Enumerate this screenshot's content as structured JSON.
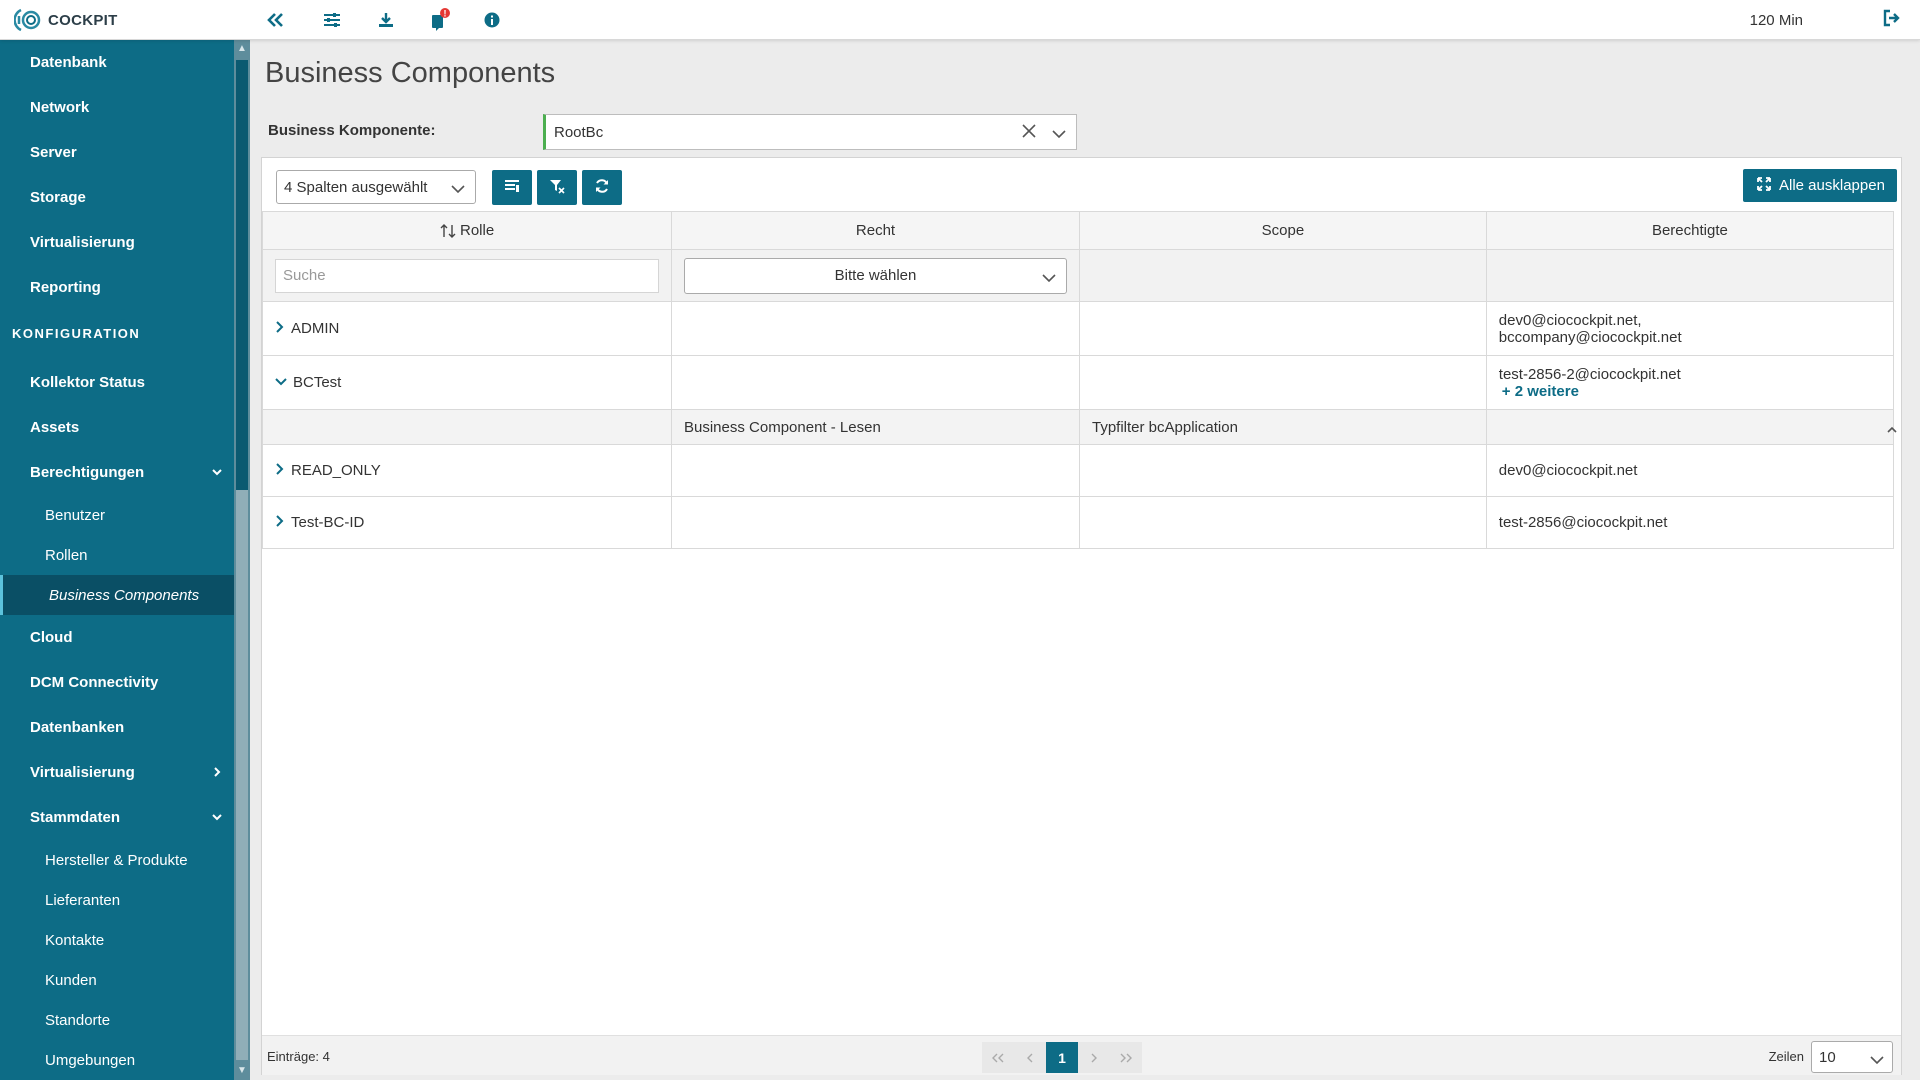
{
  "app": {
    "logo_text": "COCKPIT",
    "session_time": "120 Min"
  },
  "sidebar": {
    "items": [
      {
        "label": "Datenbank"
      },
      {
        "label": "Network"
      },
      {
        "label": "Server"
      },
      {
        "label": "Storage"
      },
      {
        "label": "Virtualisierung"
      },
      {
        "label": "Reporting"
      }
    ],
    "section": "KONFIGURATION",
    "config_items": [
      {
        "label": "Kollektor Status"
      },
      {
        "label": "Assets"
      },
      {
        "label": "Berechtigungen"
      },
      {
        "label": "Benutzer"
      },
      {
        "label": "Rollen"
      },
      {
        "label": "Business Components"
      },
      {
        "label": "Cloud"
      },
      {
        "label": "DCM Connectivity"
      },
      {
        "label": "Datenbanken"
      },
      {
        "label": "Virtualisierung"
      },
      {
        "label": "Stammdaten"
      },
      {
        "label": "Hersteller & Produkte"
      },
      {
        "label": "Lieferanten"
      },
      {
        "label": "Kontakte"
      },
      {
        "label": "Kunden"
      },
      {
        "label": "Standorte"
      },
      {
        "label": "Umgebungen"
      }
    ]
  },
  "page": {
    "title": "Business Components",
    "bc_label": "Business Komponente:",
    "bc_value": "RootBc"
  },
  "toolbar": {
    "columns_select": "4 Spalten ausgewählt",
    "expand_all": "Alle ausklappen"
  },
  "table": {
    "headers": [
      "Rolle",
      "Recht",
      "Scope",
      "Berechtigte"
    ],
    "search_placeholder": "Suche",
    "recht_filter": "Bitte wählen",
    "rows": [
      {
        "rolle": "ADMIN",
        "berechtigte_1": "dev0@ciocockpit.net,",
        "berechtigte_2": "bccompany@ciocockpit.net"
      },
      {
        "rolle": "BCTest",
        "berechtigte_1": "test-2856-2@ciocockpit.net",
        "more": "+ 2 weitere",
        "sub": {
          "recht": "Business Component - Lesen",
          "scope": "Typfilter bcApplication"
        }
      },
      {
        "rolle": "READ_ONLY",
        "berechtigte_1": "dev0@ciocockpit.net"
      },
      {
        "rolle": "Test-BC-ID",
        "berechtigte_1": "test-2856@ciocockpit.net"
      }
    ]
  },
  "footer": {
    "entries": "Einträge: 4",
    "current_page": "1",
    "rows_label": "Zeilen",
    "rows_value": "10"
  },
  "colors": {
    "primary": "#0d6c86",
    "sidebar_active": "#0a4f65",
    "notification": "#e53935",
    "valid": "#4caf50"
  }
}
